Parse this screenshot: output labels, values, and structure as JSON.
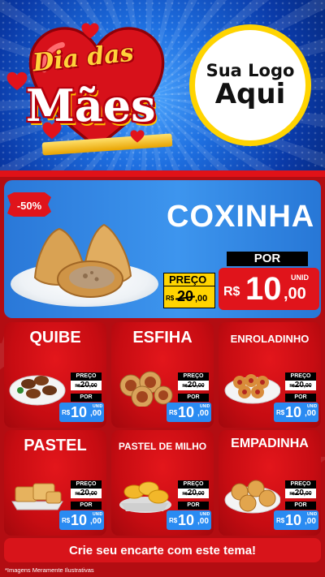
{
  "header": {
    "title_line1": "Dia das",
    "title_line2": "Mães",
    "logo_line1": "Sua Logo",
    "logo_line2": "Aqui"
  },
  "featured": {
    "discount": "-50%",
    "name": "COXINHA",
    "preco_label": "PREÇO",
    "old_price": "R$20,00",
    "old_int": "20",
    "old_dec": ",00",
    "old_rs": "R$",
    "por_label": "POR",
    "price_rs": "R$",
    "price_int": "10",
    "price_dec": ",00",
    "unit": "UNID"
  },
  "items": [
    {
      "name": "QUIBE",
      "preco_label": "PREÇO",
      "old_rs": "R$",
      "old_int": "20",
      "old_dec": ",00",
      "por_label": "POR",
      "price_rs": "R$",
      "price_int": "10",
      "price_dec": ",00",
      "unit": "UNID"
    },
    {
      "name": "ESFIHA",
      "preco_label": "PREÇO",
      "old_rs": "R$",
      "old_int": "20",
      "old_dec": ",00",
      "por_label": "POR",
      "price_rs": "R$",
      "price_int": "10",
      "price_dec": ",00",
      "unit": "UNID"
    },
    {
      "name": "ENROLADINHO",
      "preco_label": "PREÇO",
      "old_rs": "R$",
      "old_int": "20",
      "old_dec": ",00",
      "por_label": "POR",
      "price_rs": "R$",
      "price_int": "10",
      "price_dec": ",00",
      "unit": "UNID"
    },
    {
      "name": "PASTEL",
      "preco_label": "PREÇO",
      "old_rs": "R$",
      "old_int": "20",
      "old_dec": ",00",
      "por_label": "POR",
      "price_rs": "R$",
      "price_int": "10",
      "price_dec": ",00",
      "unit": "UNID"
    },
    {
      "name": "PASTEL DE MILHO",
      "preco_label": "PREÇO",
      "old_rs": "R$",
      "old_int": "20",
      "old_dec": ",00",
      "por_label": "POR",
      "price_rs": "R$",
      "price_int": "10",
      "price_dec": ",00",
      "unit": "UNID"
    },
    {
      "name": "EMPADINHA",
      "preco_label": "PREÇO",
      "old_rs": "R$",
      "old_int": "20",
      "old_dec": ",00",
      "por_label": "POR",
      "price_rs": "R$",
      "price_int": "10",
      "price_dec": ",00",
      "unit": "UNID"
    }
  ],
  "cta": "Crie seu encarte com este tema!",
  "disclaimer": "*Imagens Meramente Ilustrativas",
  "colors": {
    "blue": "#1e6fe0",
    "red": "#d8141a",
    "yellow": "#ffd400",
    "price_blue": "#2a8bf2"
  }
}
